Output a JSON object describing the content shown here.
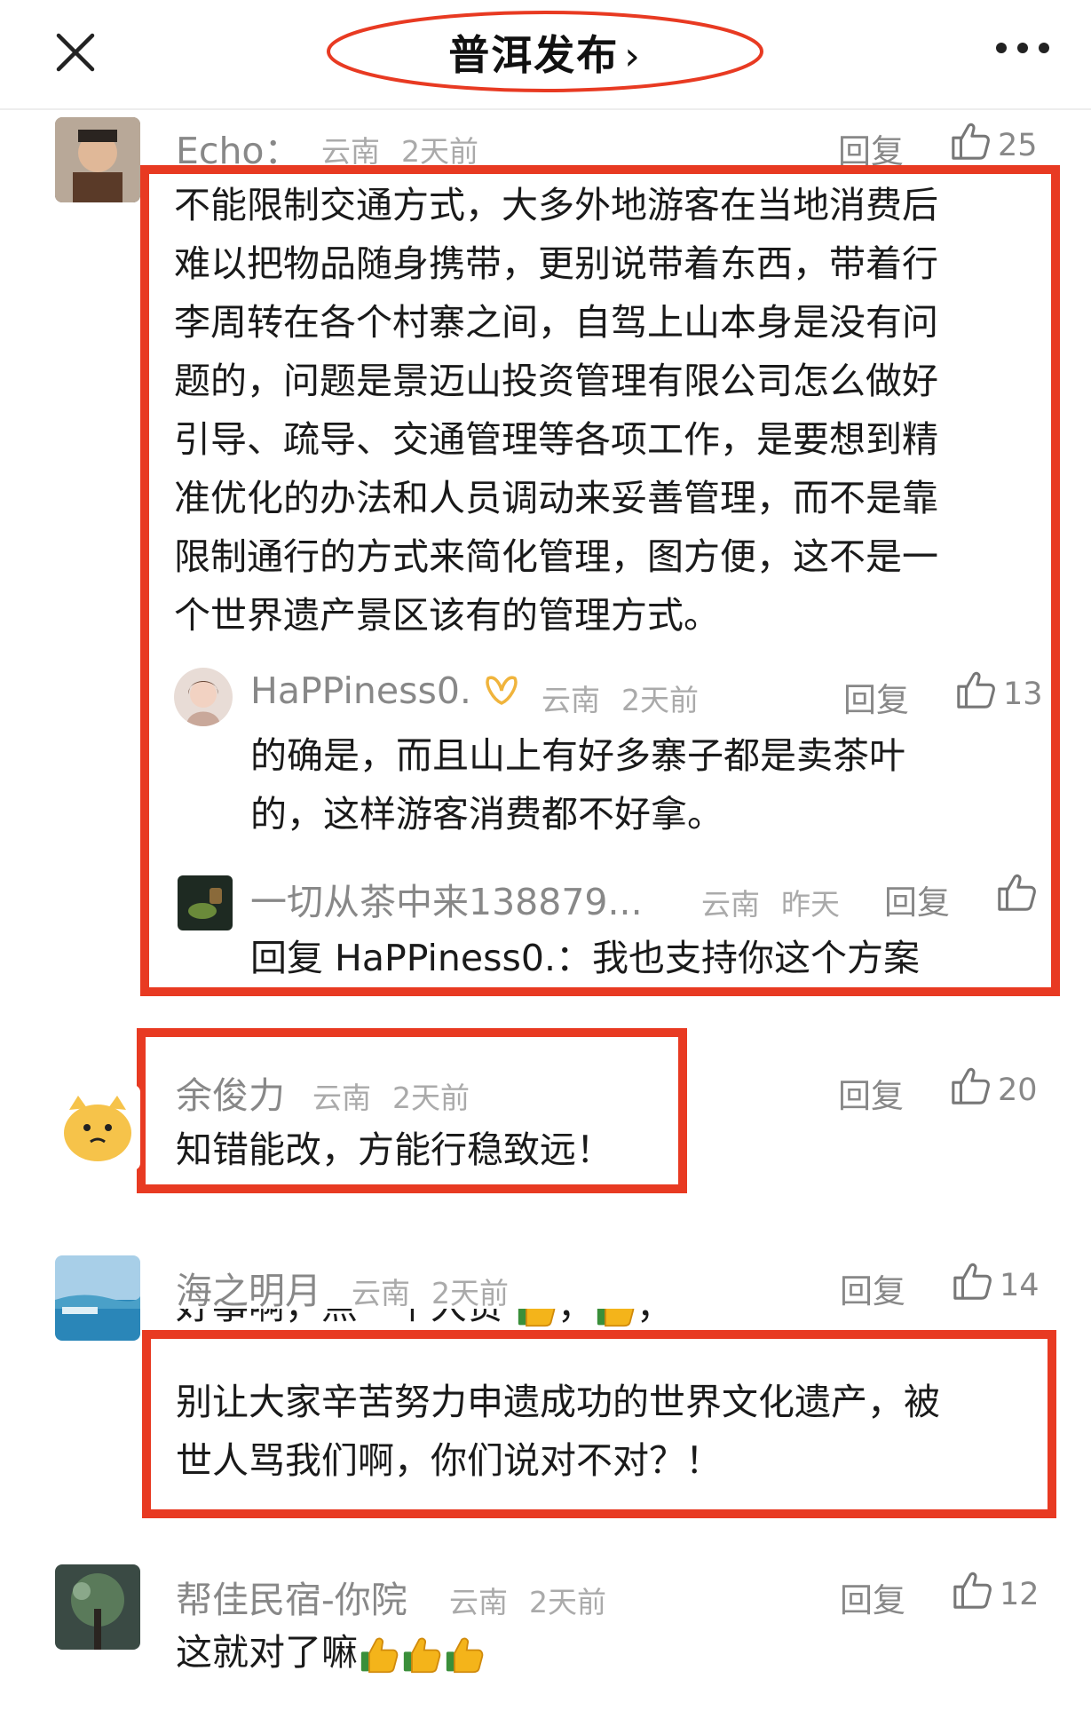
{
  "header": {
    "title": "普洱发布",
    "chevron": "›",
    "close_icon": "close-icon",
    "more_icon": "more-icon"
  },
  "comments": [
    {
      "name": "Echo：",
      "location": "云南",
      "time": "2天前",
      "reply": "回复",
      "likes": "25",
      "lines": [
        "不能限制交通方式，大多外地游客在当地消费后",
        "难以把物品随身携带，更别说带着东西，带着行",
        "李周转在各个村寨之间，自驾上山本身是没有问",
        "题的，问题是景迈山投资管理有限公司怎么做好",
        "引导、疏导、交通管理等各项工作，是要想到精",
        "准优化的办法和人员调动来妥善管理，而不是靠",
        "限制通行的方式来简化管理，图方便，这不是一",
        "个世界遗产景区该有的管理方式。"
      ],
      "replies": [
        {
          "name": "HaPPiness0.",
          "location": "云南",
          "time": "2天前",
          "reply": "回复",
          "likes": "13",
          "lines": [
            "的确是，而且山上有好多寨子都是卖茶叶",
            "的，这样游客消费都不好拿。"
          ]
        },
        {
          "name": "一切从茶中来138879...",
          "location": "云南",
          "time": "昨天",
          "reply": "回复",
          "likes": "",
          "reply_prefix": "回复 HaPPiness0.：",
          "text": "我也支持你这个方案"
        }
      ]
    },
    {
      "name": "余俊力",
      "location": "云南",
      "time": "2天前",
      "reply": "回复",
      "likes": "20",
      "text": "知错能改，方能行稳致远！"
    },
    {
      "name": "海之明月",
      "location": "云南",
      "time": "2天前",
      "reply": "回复",
      "likes": "14",
      "partial": "好事啊，点一个大赞",
      "lines": [
        "别让大家辛苦努力申遗成功的世界文化遗产，被",
        "世人骂我们啊，你们说对不对？！"
      ]
    },
    {
      "name": "帮佳民宿-你院",
      "location": "云南",
      "time": "2天前",
      "reply": "回复",
      "likes": "12",
      "text": "这就对了嘛"
    }
  ],
  "colors": {
    "highlight": "#e83a22",
    "muted": "#888888",
    "text": "#1a1a1a"
  }
}
